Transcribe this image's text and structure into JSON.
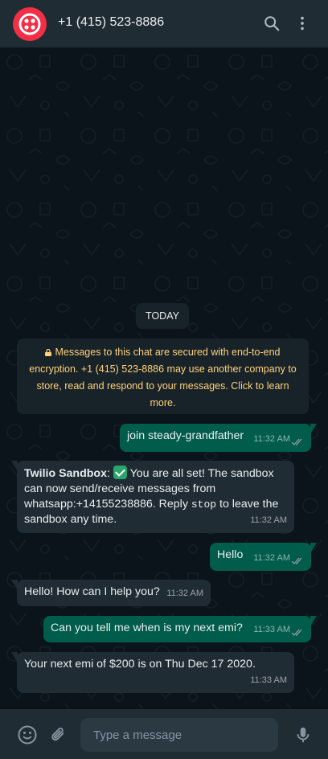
{
  "header": {
    "contact_name": "+1 (415) 523-8886",
    "avatar_icon": "twilio-logo-icon",
    "search_icon": "search-icon",
    "menu_icon": "more-vertical-icon",
    "brand_color": "#f22f46"
  },
  "chat": {
    "date_label": "TODAY",
    "encryption_notice": "Messages to this chat are secured with end-to-end encryption. +1 (415) 523-8886 may use another company to store, read and respond to your messages. Click to learn more.",
    "messages": [
      {
        "direction": "out",
        "text": "join steady-grandfather",
        "time": "11:32 AM",
        "status": "read"
      },
      {
        "direction": "in",
        "sender": "Twilio Sandbox",
        "text_part1": ":",
        "text_part2": " You are all set! The sandbox can now send/receive messages from whatsapp:+14155238886. Reply ",
        "code": "stop",
        "text_part3": " to leave the sandbox any time.",
        "time": "11:32 AM"
      },
      {
        "direction": "out",
        "text": "Hello",
        "time": "11:32 AM",
        "status": "read"
      },
      {
        "direction": "in",
        "text": "Hello! How can I help you?",
        "time": "11:32 AM"
      },
      {
        "direction": "out",
        "text": "Can you tell me when is my next emi?",
        "time": "11:33 AM",
        "status": "read"
      },
      {
        "direction": "in",
        "text": "Your next emi of $200 is on Thu Dec 17 2020.",
        "time": "11:33 AM"
      }
    ]
  },
  "composer": {
    "placeholder": "Type a message",
    "emoji_icon": "emoji-icon",
    "attach_icon": "paperclip-icon",
    "mic_icon": "microphone-icon"
  },
  "colors": {
    "outgoing_bubble": "#005c4b",
    "incoming_bubble": "#202c33",
    "notice_text": "#ffd279"
  }
}
